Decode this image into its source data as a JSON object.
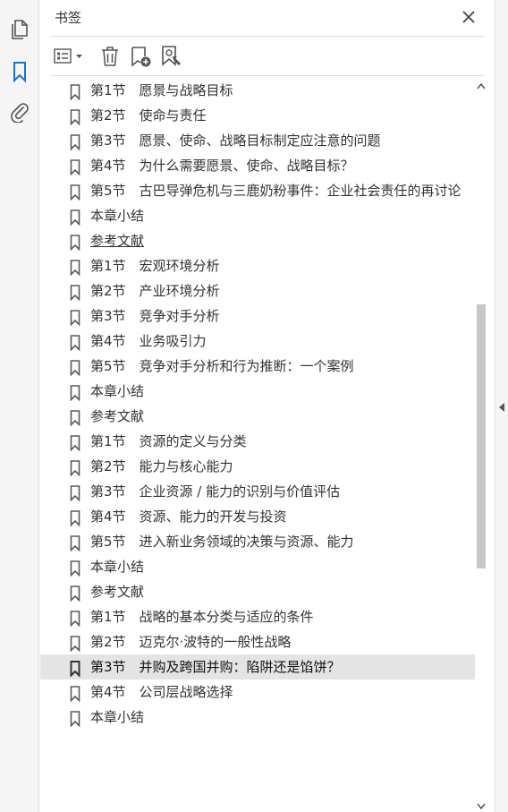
{
  "panel": {
    "title": "书签"
  },
  "bookmarks": [
    {
      "label": "第1节　愿景与战略目标"
    },
    {
      "label": "第2节　使命与责任"
    },
    {
      "label": "第3节　愿景、使命、战略目标制定应注意的问题"
    },
    {
      "label": "第4节　为什么需要愿景、使命、战略目标？"
    },
    {
      "label": "第5节　古巴导弹危机与三鹿奶粉事件：企业社会责任的再讨论"
    },
    {
      "label": "本章小结"
    },
    {
      "label": "参考文献"
    },
    {
      "label": "第1节　宏观环境分析"
    },
    {
      "label": "第2节　产业环境分析"
    },
    {
      "label": "第3节　竞争对手分析"
    },
    {
      "label": "第4节　业务吸引力"
    },
    {
      "label": "第5节　竞争对手分析和行为推断：一个案例"
    },
    {
      "label": "本章小结"
    },
    {
      "label": "参考文献"
    },
    {
      "label": "第1节　资源的定义与分类"
    },
    {
      "label": "第2节　能力与核心能力"
    },
    {
      "label": "第3节　企业资源 / 能力的识别与价值评估"
    },
    {
      "label": "第4节　资源、能力的开发与投资"
    },
    {
      "label": "第5节　进入新业务领域的决策与资源、能力"
    },
    {
      "label": "本章小结"
    },
    {
      "label": "参考文献"
    },
    {
      "label": "第1节　战略的基本分类与适应的条件"
    },
    {
      "label": "第2节　迈克尔·波特的一般性战略"
    },
    {
      "label": "第3节　并购及跨国并购：陷阱还是馅饼？"
    },
    {
      "label": "第4节　公司层战略选择"
    },
    {
      "label": "本章小结"
    }
  ],
  "colors": {
    "accent": "#1a73c8",
    "selected_bg": "#e4e4e4",
    "icon": "#5a5a5a"
  }
}
